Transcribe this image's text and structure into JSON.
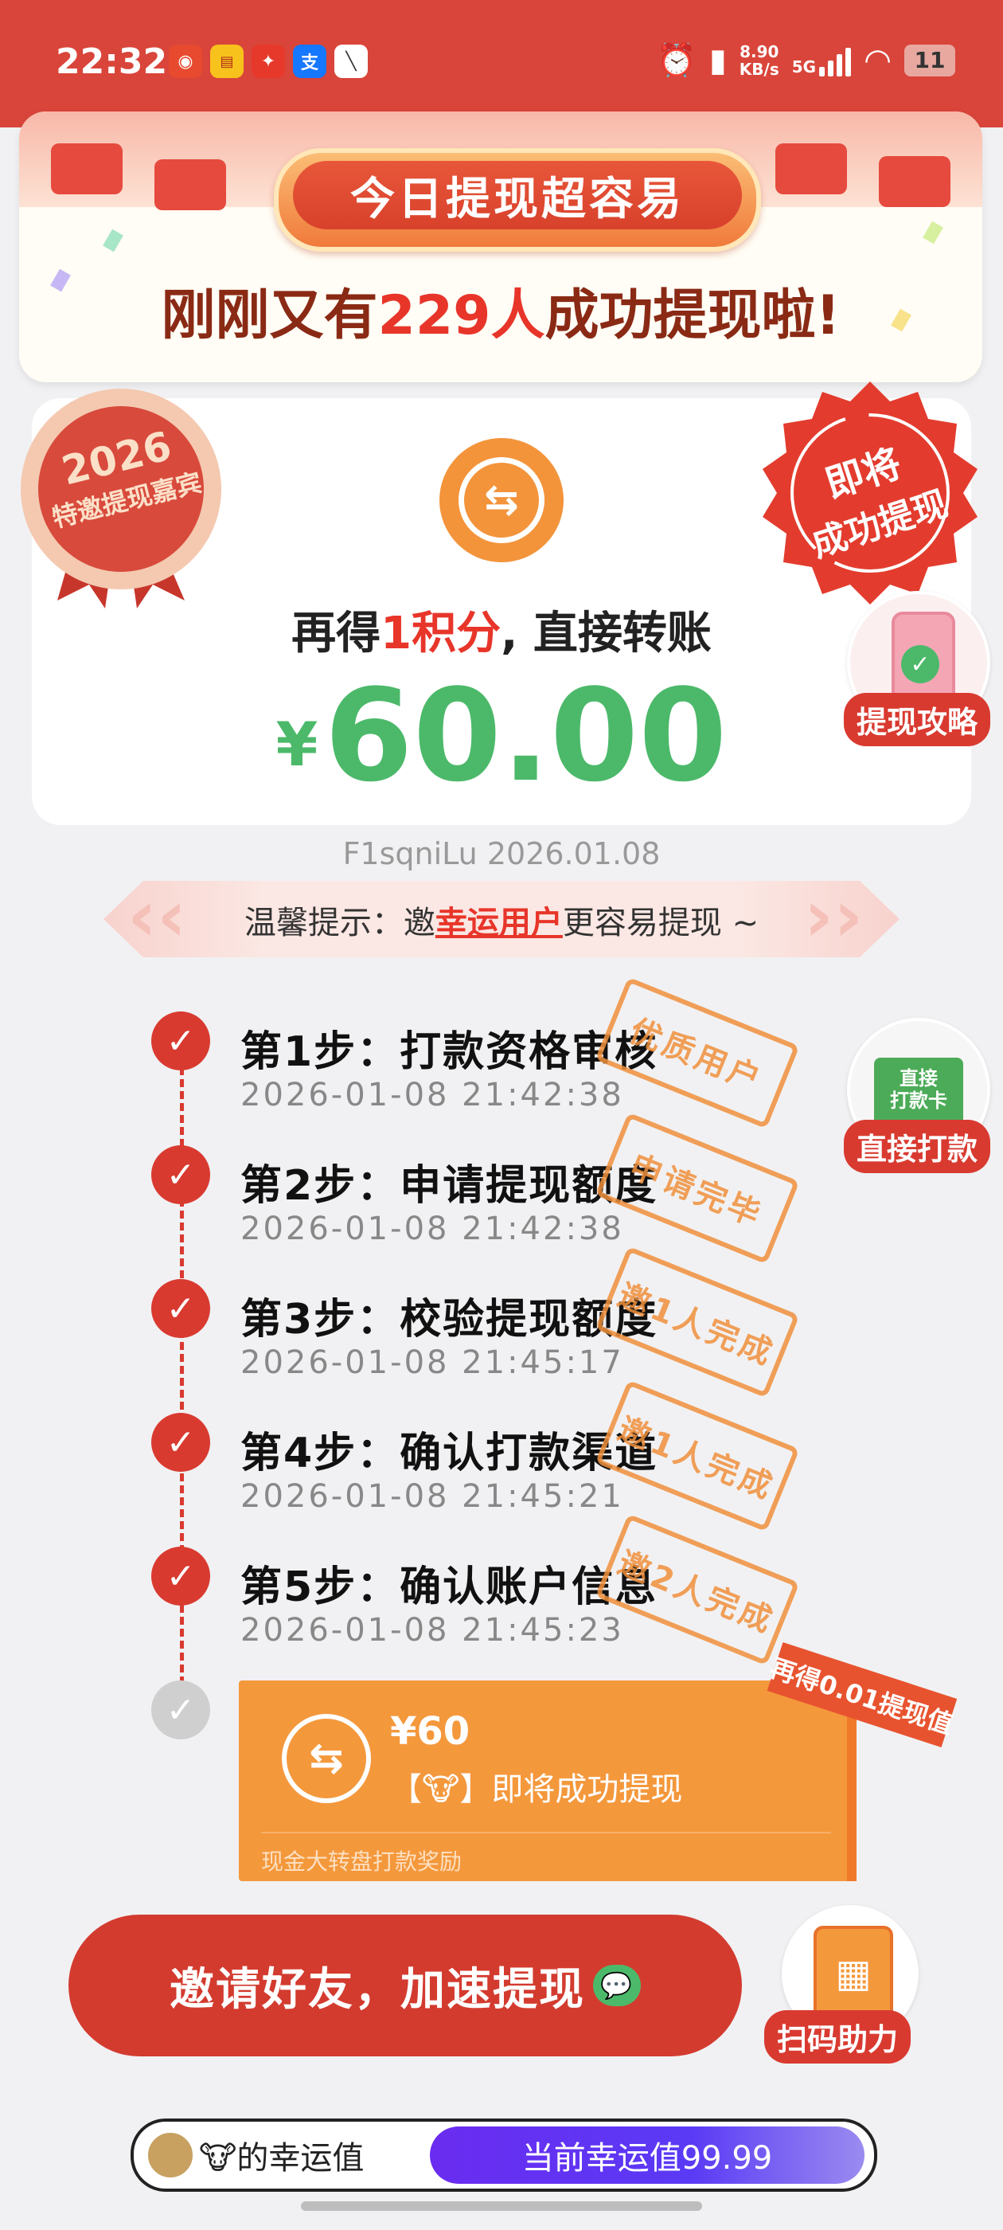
{
  "status_bar": {
    "time": "22:32",
    "network_speed_value": "8.90",
    "network_speed_unit": "KB/s",
    "signal": "5G",
    "battery": "11",
    "app_icons": [
      "app-1-icon",
      "app-2-icon",
      "app-3-icon",
      "alipay-icon",
      "app-5-icon"
    ]
  },
  "banner": {
    "pill_title": "今日提现超容易",
    "msg_prefix": "刚刚又有",
    "msg_count": "229人",
    "msg_suffix": "成功提现啦!"
  },
  "badge_2026": {
    "year": "2026",
    "text": "特邀提现嘉宾"
  },
  "stamp_soon": {
    "line1": "即将",
    "line2": "成功提现"
  },
  "card": {
    "line_prefix": "再得",
    "line_points": "1积分",
    "line_suffix": ", 直接转账",
    "currency": "¥",
    "amount": "60.00"
  },
  "side_buttons": {
    "guide": "提现攻略",
    "direct_pay": "直接打款",
    "direct_pay_card_l1": "直接",
    "direct_pay_card_l2": "打款卡",
    "scan_help": "扫码助力"
  },
  "id_line": "F1sqniLu 2026.01.08",
  "tip": {
    "prefix": "温馨提示：邀",
    "link": "幸运用户",
    "suffix": "更容易提现 ~"
  },
  "steps": [
    {
      "title": "第1步：打款资格审核",
      "time": "2026-01-08 21:42:38",
      "stamp": "优质用户"
    },
    {
      "title": "第2步：申请提现额度",
      "time": "2026-01-08 21:42:38",
      "stamp": "申请完毕"
    },
    {
      "title": "第3步：校验提现额度",
      "time": "2026-01-08 21:45:17",
      "stamp": "邀1人完成"
    },
    {
      "title": "第4步：确认打款渠道",
      "time": "2026-01-08 21:45:21",
      "stamp": "邀1人完成"
    },
    {
      "title": "第5步：确认账户信息",
      "time": "2026-01-08 21:45:23",
      "stamp": "邀2人完成"
    }
  ],
  "payout": {
    "amount": "¥60",
    "subtitle": "【🐮】即将成功提现",
    "footer": "现金大转盘打款奖励",
    "ribbon": "再得0.01提现值"
  },
  "invite_button": "邀请好友，加速提现",
  "luck": {
    "label_suffix": "🐮的幸运值",
    "value_text": "当前幸运值99.99",
    "value_fraction": 0.9999
  },
  "colors": {
    "brand_red": "#d93a30",
    "amount_green": "#4cb96a",
    "orange": "#f4983c",
    "purple": "#6a2cf0"
  }
}
